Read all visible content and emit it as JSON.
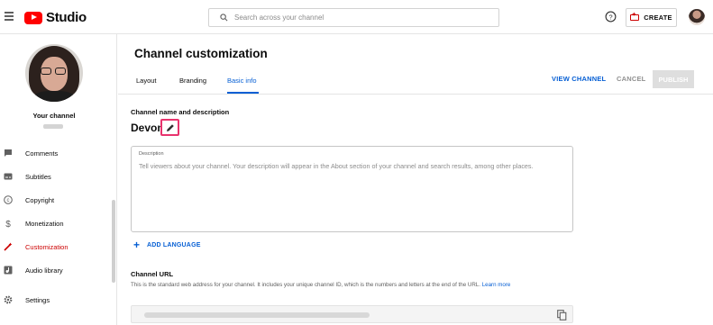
{
  "header": {
    "logo_text": "Studio",
    "search_placeholder": "Search across your channel",
    "create_label": "CREATE",
    "icons": [
      "hamburger-icon",
      "youtube-logo-icon",
      "search-icon",
      "help-icon",
      "create-video-icon",
      "avatar"
    ]
  },
  "sidebar": {
    "your_channel": "Your channel",
    "items": [
      {
        "label": "Comments",
        "icon": "comment-icon"
      },
      {
        "label": "Subtitles",
        "icon": "subtitles-icon"
      },
      {
        "label": "Copyright",
        "icon": "copyright-icon"
      },
      {
        "label": "Monetization",
        "icon": "dollar-icon"
      },
      {
        "label": "Customization",
        "icon": "magic-wand-icon",
        "active": true
      },
      {
        "label": "Audio library",
        "icon": "audio-library-icon"
      },
      {
        "label": "Settings",
        "icon": "gear-icon"
      }
    ]
  },
  "main": {
    "title": "Channel customization",
    "tabs": [
      "Layout",
      "Branding",
      "Basic info"
    ],
    "active_tab": "Basic info",
    "actions": {
      "view_channel": "VIEW CHANNEL",
      "cancel": "CANCEL",
      "publish": "PUBLISH"
    },
    "name_section": {
      "label": "Channel name and description",
      "channel_name": "Devon",
      "description_label": "Description",
      "description_placeholder": "Tell viewers about your channel. Your description will appear in the About section of your channel and search results, among other places."
    },
    "add_language": "ADD LANGUAGE",
    "url_section": {
      "label": "Channel URL",
      "help": "This is the standard web address for your channel. It includes your unique channel ID, which is the numbers and letters at the end of the URL.",
      "learn_more": "Learn more"
    }
  },
  "colors": {
    "accent_blue": "#065fd4",
    "active_red": "#cc0000",
    "highlight_pink": "#e8336d"
  }
}
